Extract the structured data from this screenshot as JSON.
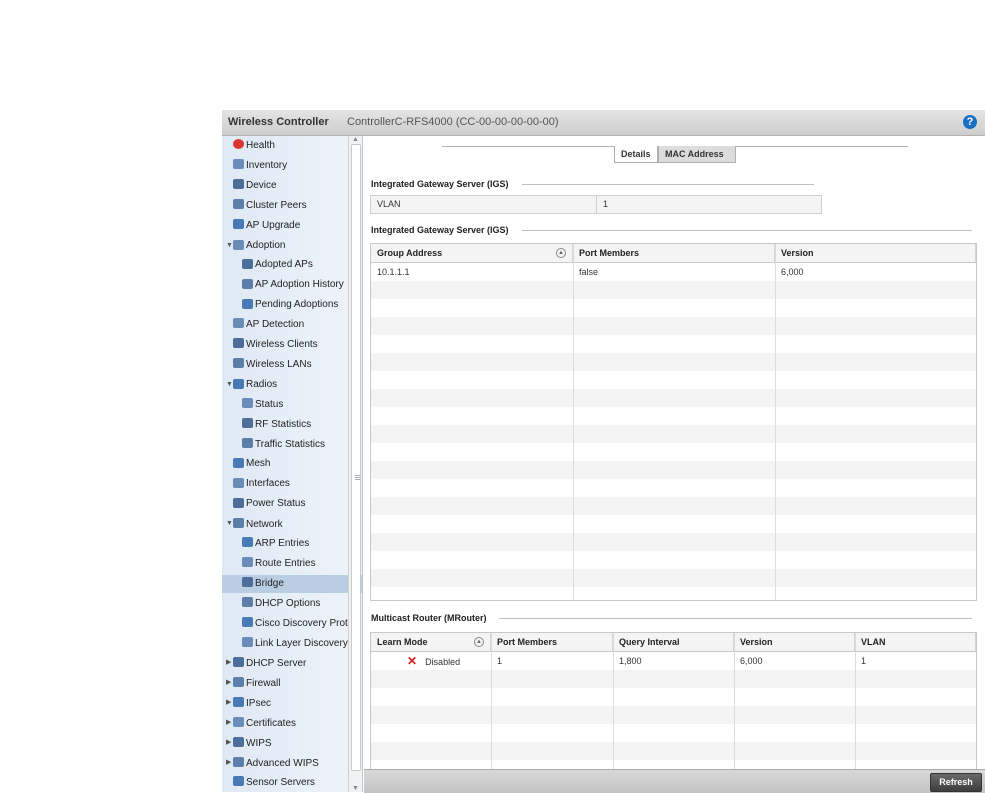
{
  "header": {
    "title": "Wireless Controller",
    "subtitle": "ControllerC-RFS4000 (CC-00-00-00-00-00)",
    "help": "?"
  },
  "sidebar": {
    "items": [
      {
        "label": "Health",
        "icon": "health-icon",
        "indent": 0,
        "arrow": ""
      },
      {
        "label": "Inventory",
        "icon": "inventory-icon",
        "indent": 0,
        "arrow": ""
      },
      {
        "label": "Device",
        "icon": "device-icon",
        "indent": 0,
        "arrow": ""
      },
      {
        "label": "Cluster Peers",
        "icon": "cluster-icon",
        "indent": 0,
        "arrow": ""
      },
      {
        "label": "AP Upgrade",
        "icon": "ap-upgrade-icon",
        "indent": 0,
        "arrow": ""
      },
      {
        "label": "Adoption",
        "icon": "adoption-icon",
        "indent": 0,
        "arrow": "▼"
      },
      {
        "label": "Adopted APs",
        "icon": "adopted-aps-icon",
        "indent": 1,
        "arrow": ""
      },
      {
        "label": "AP Adoption History",
        "icon": "adoption-history-icon",
        "indent": 1,
        "arrow": ""
      },
      {
        "label": "Pending Adoptions",
        "icon": "pending-adoptions-icon",
        "indent": 1,
        "arrow": ""
      },
      {
        "label": "AP Detection",
        "icon": "ap-detection-icon",
        "indent": 0,
        "arrow": ""
      },
      {
        "label": "Wireless Clients",
        "icon": "wireless-clients-icon",
        "indent": 0,
        "arrow": ""
      },
      {
        "label": "Wireless LANs",
        "icon": "wireless-lans-icon",
        "indent": 0,
        "arrow": ""
      },
      {
        "label": "Radios",
        "icon": "radios-icon",
        "indent": 0,
        "arrow": "▼"
      },
      {
        "label": "Status",
        "icon": "radio-status-icon",
        "indent": 1,
        "arrow": ""
      },
      {
        "label": "RF Statistics",
        "icon": "rf-statistics-icon",
        "indent": 1,
        "arrow": ""
      },
      {
        "label": "Traffic Statistics",
        "icon": "traffic-statistics-icon",
        "indent": 1,
        "arrow": ""
      },
      {
        "label": "Mesh",
        "icon": "mesh-icon",
        "indent": 0,
        "arrow": ""
      },
      {
        "label": "Interfaces",
        "icon": "interfaces-icon",
        "indent": 0,
        "arrow": ""
      },
      {
        "label": "Power Status",
        "icon": "power-status-icon",
        "indent": 0,
        "arrow": ""
      },
      {
        "label": "Network",
        "icon": "network-icon",
        "indent": 0,
        "arrow": "▼"
      },
      {
        "label": "ARP Entries",
        "icon": "arp-entries-icon",
        "indent": 1,
        "arrow": ""
      },
      {
        "label": "Route Entries",
        "icon": "route-entries-icon",
        "indent": 1,
        "arrow": ""
      },
      {
        "label": "Bridge",
        "icon": "bridge-icon",
        "indent": 1,
        "arrow": "",
        "selected": true
      },
      {
        "label": "DHCP Options",
        "icon": "dhcp-options-icon",
        "indent": 1,
        "arrow": ""
      },
      {
        "label": "Cisco Discovery Prot",
        "icon": "cdp-icon",
        "indent": 1,
        "arrow": ""
      },
      {
        "label": "Link Layer Discovery",
        "icon": "lldp-icon",
        "indent": 1,
        "arrow": ""
      },
      {
        "label": "DHCP Server",
        "icon": "dhcp-server-icon",
        "indent": 0,
        "arrow": "▶"
      },
      {
        "label": "Firewall",
        "icon": "firewall-icon",
        "indent": 0,
        "arrow": "▶"
      },
      {
        "label": "IPsec",
        "icon": "ipsec-icon",
        "indent": 0,
        "arrow": "▶"
      },
      {
        "label": "Certificates",
        "icon": "certificates-icon",
        "indent": 0,
        "arrow": "▶"
      },
      {
        "label": "WIPS",
        "icon": "wips-icon",
        "indent": 0,
        "arrow": "▶"
      },
      {
        "label": "Advanced WIPS",
        "icon": "advanced-wips-icon",
        "indent": 0,
        "arrow": "▶"
      },
      {
        "label": "Sensor Servers",
        "icon": "sensor-servers-icon",
        "indent": 0,
        "arrow": ""
      }
    ]
  },
  "tabs": {
    "details": "Details",
    "mac": "MAC Address"
  },
  "igs_section": {
    "title": "Integrated Gateway Server (IGS)",
    "vlan_label": "VLAN",
    "vlan_value": "1"
  },
  "igs_table": {
    "title": "Integrated Gateway Server (IGS)",
    "columns": [
      "Group Address",
      "Port Members",
      "Version"
    ],
    "rows": [
      [
        "10.1.1.1",
        "false",
        "6,000"
      ]
    ]
  },
  "mrouter_table": {
    "title": "Multicast Router (MRouter)",
    "columns": [
      "Learn Mode",
      "Port Members",
      "Query Interval",
      "Version",
      "VLAN"
    ],
    "rows": [
      [
        "Disabled",
        "1",
        "1,800",
        "6,000",
        "1"
      ]
    ]
  },
  "footer": {
    "refresh_label": "Refresh"
  },
  "colors": {
    "accent": "#1a6fc4",
    "selected": "#b9cde3",
    "disabled_x": "#d21f1f"
  }
}
